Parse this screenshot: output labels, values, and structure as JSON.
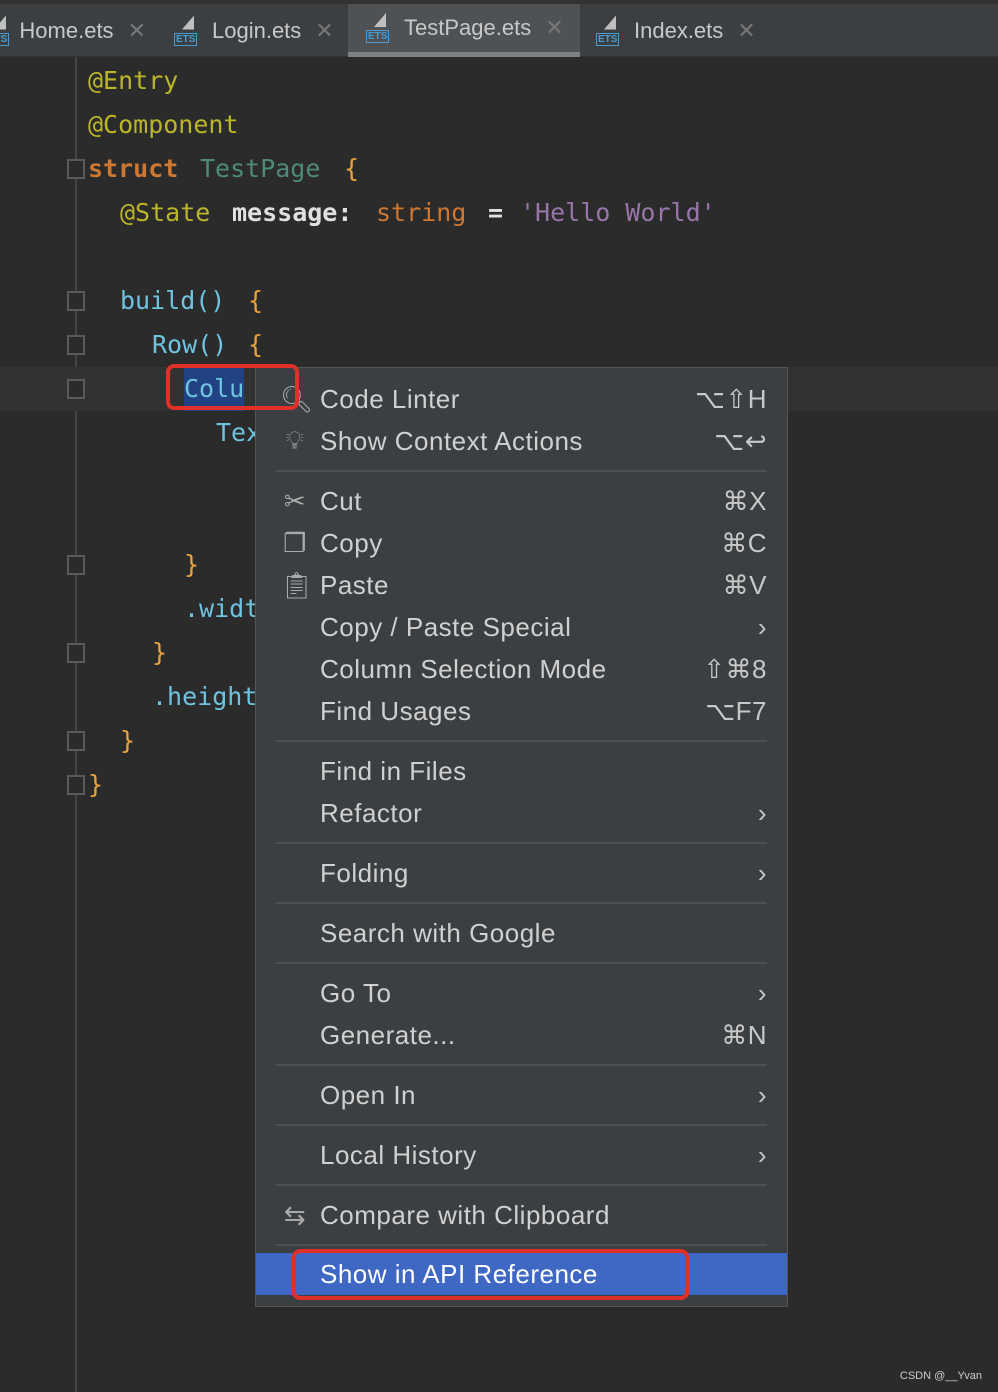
{
  "tabs": [
    {
      "label": "Home.ets",
      "active": false
    },
    {
      "label": "Login.ets",
      "active": false
    },
    {
      "label": "TestPage.ets",
      "active": true
    },
    {
      "label": "Index.ets",
      "active": false
    }
  ],
  "code": {
    "l0": "@Entry",
    "l1": "@Component",
    "l2a": "struct",
    "l2b": "TestPage",
    "l2c": "{",
    "l3a": "@State",
    "l3b": "message:",
    "l3c": "string",
    "l3d": "=",
    "l3e": "'Hello World'",
    "l5a": "build()",
    "l5b": "{",
    "l6a": "Row()",
    "l6b": "{",
    "l7": "Colu",
    "l8": "Tex",
    "l11": "}",
    "l12": ".widt",
    "l13": "}",
    "l14": ".height",
    "l15": "}",
    "l16": "}"
  },
  "menu": {
    "items": [
      {
        "icon": "code-linter-icon",
        "label": "Code Linter",
        "shortcut": "⌥⇧H"
      },
      {
        "icon": "lightbulb-icon",
        "label": "Show Context Actions",
        "shortcut": "⌥↩"
      },
      {
        "sep": true
      },
      {
        "icon": "scissors-icon",
        "label": "Cut",
        "shortcut": "⌘X"
      },
      {
        "icon": "copy-icon",
        "label": "Copy",
        "shortcut": "⌘C"
      },
      {
        "icon": "clipboard-icon",
        "label": "Paste",
        "shortcut": "⌘V"
      },
      {
        "label": "Copy / Paste Special",
        "shortcut": "›"
      },
      {
        "label": "Column Selection Mode",
        "shortcut": "⇧⌘8"
      },
      {
        "label": "Find Usages",
        "shortcut": "⌥F7"
      },
      {
        "sep": true
      },
      {
        "label": "Find in Files",
        "shortcut": ""
      },
      {
        "label": "Refactor",
        "shortcut": "›"
      },
      {
        "sep": true
      },
      {
        "label": "Folding",
        "shortcut": "›"
      },
      {
        "sep": true
      },
      {
        "label": "Search with Google",
        "shortcut": ""
      },
      {
        "sep": true
      },
      {
        "label": "Go To",
        "shortcut": "›"
      },
      {
        "label": "Generate...",
        "shortcut": "⌘N"
      },
      {
        "sep": true
      },
      {
        "label": "Open In",
        "shortcut": "›"
      },
      {
        "sep": true
      },
      {
        "label": "Local History",
        "shortcut": "›"
      },
      {
        "sep": true
      },
      {
        "icon": "compare-clipboard-icon",
        "label": "Compare with Clipboard",
        "shortcut": ""
      },
      {
        "sep": true
      },
      {
        "label": "Show in API Reference",
        "shortcut": "",
        "highlighted": true
      }
    ]
  },
  "colors": {
    "highlight": "#3f68c4",
    "annotation_box": "#e0302a"
  },
  "watermark": "CSDN @__Yvan"
}
